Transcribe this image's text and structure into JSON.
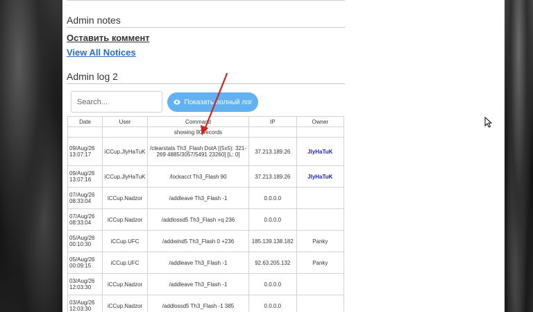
{
  "admin_notes": {
    "title": "Admin notes",
    "leave_comment": "Оставить коммент",
    "view_all": "View All Notices"
  },
  "admin_log": {
    "title": "Admin log 2",
    "search_placeholder": "Search...",
    "full_log_button": "Показать полный лог",
    "columns": [
      "Date",
      "User",
      "Command",
      "IP",
      "Owner"
    ],
    "records_info": "showing 90 records",
    "rows": [
      {
        "date": "09/Aug/26 13:07:17",
        "user": "iCCup.JlyHaTuK",
        "command": "/clearstats Th3_Flash DotA [(5x5): 321-269 4885/3057/5491 23260] [L: 0]",
        "ip": "37.213.189.26",
        "owner": "JlyHaTuK"
      },
      {
        "date": "09/Aug/26 13:07:16",
        "user": "iCCup.JlyHaTuK",
        "command": "/lockacct Th3_Flash 90",
        "ip": "37.213.189.26",
        "owner": "JlyHaTuK"
      },
      {
        "date": "07/Aug/26 08:33:04",
        "user": "iCCup.Nadzor",
        "command": "/addleave Th3_Flash -1",
        "ip": "0.0.0.0",
        "owner": ""
      },
      {
        "date": "07/Aug/26 08:33:04",
        "user": "iCCup.Nadzor",
        "command": "/addlossd5 Th3_Flash +q 236",
        "ip": "0.0.0.0",
        "owner": ""
      },
      {
        "date": "05/Aug/26 00:10:30",
        "user": "iCCup.UFC",
        "command": "/addwind5 Th3_Flash 0 +236",
        "ip": "185.139.138.182",
        "owner": "Panky"
      },
      {
        "date": "05/Aug/26 00:09:15",
        "user": "iCCup.UFC",
        "command": "/addleave Th3_Flash -1",
        "ip": "92.63.205.132",
        "owner": "Panky"
      },
      {
        "date": "03/Aug/26 12:03:30",
        "user": "iCCup.Nadzor",
        "command": "/addleave Th3_Flash -1",
        "ip": "0.0.0.0",
        "owner": ""
      },
      {
        "date": "03/Aug/26 12:03:30",
        "user": "iCCup.Nadzor",
        "command": "/addlossd5 Th3_Flash -1 385",
        "ip": "0.0.0.0",
        "owner": ""
      }
    ]
  },
  "icons": [
    "eye-icon",
    "red-arrow-annotation",
    "mouse-cursor-icon"
  ],
  "colors": {
    "button": "#62b2f2",
    "link": "#2a6ac8",
    "owner_link": "#2222cc",
    "arrow": "#d42020"
  }
}
